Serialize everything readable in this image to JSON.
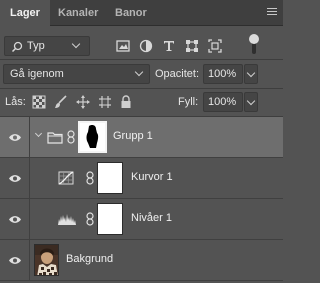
{
  "tabs": [
    {
      "label": "Lager",
      "active": true
    },
    {
      "label": "Kanaler",
      "active": false
    },
    {
      "label": "Banor",
      "active": false
    }
  ],
  "filter": {
    "type_label": "Typ",
    "icons": [
      "image-filter-icon",
      "adjustment-filter-icon",
      "type-filter-icon",
      "shape-filter-icon",
      "smart-object-filter-icon"
    ]
  },
  "blend": {
    "mode": "Gå igenom",
    "opacity_label": "Opacitet:",
    "opacity_value": "100%"
  },
  "lock": {
    "label": "Lås:",
    "fill_label": "Fyll:",
    "fill_value": "100%"
  },
  "layers": [
    {
      "name": "Grupp 1",
      "kind": "group",
      "selected": true,
      "visible": true
    },
    {
      "name": "Kurvor 1",
      "kind": "curves",
      "selected": false,
      "visible": true
    },
    {
      "name": "Nivåer 1",
      "kind": "levels",
      "selected": false,
      "visible": true
    },
    {
      "name": "Bakgrund",
      "kind": "background",
      "selected": false,
      "visible": true
    }
  ],
  "colors": {
    "panel_bg": "#535353",
    "tabbar_bg": "#3f3f3f",
    "selected_row": "#6e6e6e",
    "field_bg": "#454545"
  }
}
